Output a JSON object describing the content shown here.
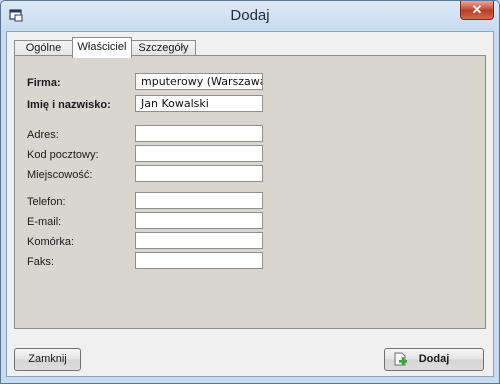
{
  "window": {
    "title": "Dodaj",
    "close_label": "✕"
  },
  "tabs": [
    {
      "label": "Ogólne"
    },
    {
      "label": "Właściciel"
    },
    {
      "label": "Szczegóły"
    }
  ],
  "form": {
    "firma": {
      "label": "Firma:",
      "value": "mputerowy (Warszawa)"
    },
    "imie": {
      "label": "Imię i nazwisko:",
      "value": "Jan Kowalski"
    },
    "adres": {
      "label": "Adres:",
      "value": ""
    },
    "kod": {
      "label": "Kod pocztowy:",
      "value": ""
    },
    "miejscowosc": {
      "label": "Miejscowość:",
      "value": ""
    },
    "telefon": {
      "label": "Telefon:",
      "value": ""
    },
    "email": {
      "label": "E-mail:",
      "value": ""
    },
    "komorka": {
      "label": "Komórka:",
      "value": ""
    },
    "faks": {
      "label": "Faks:",
      "value": ""
    }
  },
  "buttons": {
    "close": "Zamknij",
    "add": "Dodaj"
  },
  "icons": {
    "app": "window-icon",
    "add": "add-document-icon"
  },
  "colors": {
    "panel": "#d9d6d0",
    "close_button": "#c9503b"
  }
}
